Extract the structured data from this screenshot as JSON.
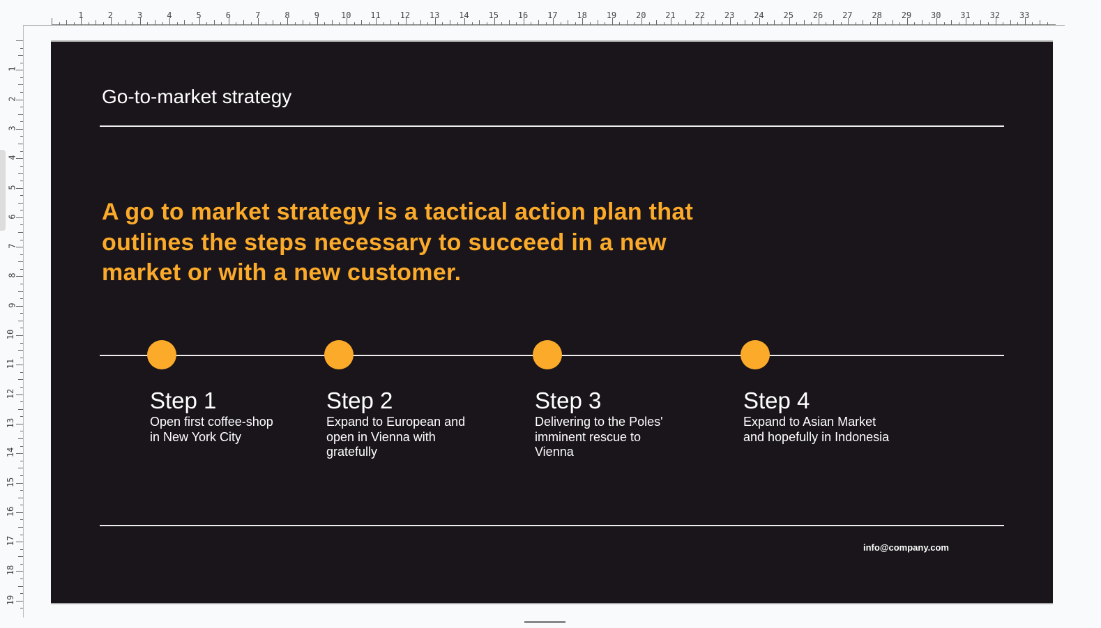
{
  "ruler": {
    "horizontal_max": 33,
    "vertical_max": 19
  },
  "slide": {
    "title": "Go-to-market strategy",
    "headline": "A go to market strategy is a tactical action plan that outlines the steps necessary to succeed in a new market or with a new customer.",
    "steps": [
      {
        "label": "Step 1",
        "text": "Open first coffee-shop in New York City"
      },
      {
        "label": "Step 2",
        "text": "Expand to European and open in Vienna with gratefully"
      },
      {
        "label": "Step 3",
        "text": "Delivering to the Poles' imminent rescue to Vienna"
      },
      {
        "label": "Step 4",
        "text": "Expand to Asian Market and hopefully in Indonesia"
      }
    ],
    "email": "info@company.com"
  },
  "colors": {
    "background": "#19151a",
    "accent": "#fbaa2a",
    "text": "#ffffff"
  }
}
